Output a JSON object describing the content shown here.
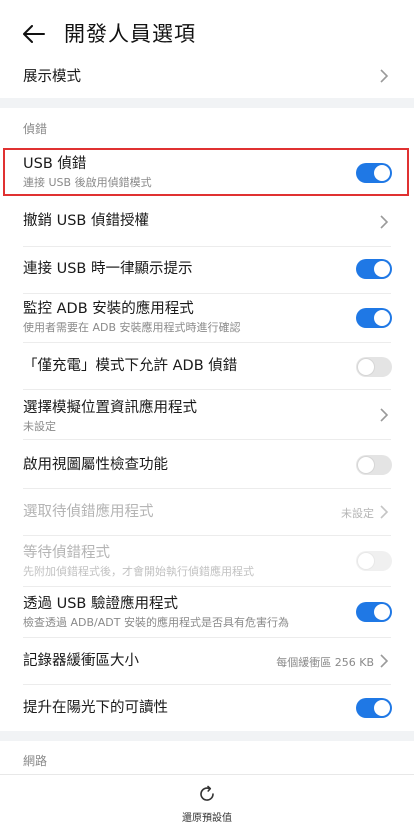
{
  "header": {
    "title": "開發人員選項"
  },
  "display_mode": {
    "label": "展示模式"
  },
  "debug_section": {
    "label": "偵錯"
  },
  "usb_debug": {
    "label": "USB 偵錯",
    "desc": "連接 USB 後啟用偵錯模式",
    "state": "on"
  },
  "revoke_usb": {
    "label": "撤銷 USB 偵錯授權"
  },
  "usb_notify": {
    "label": "連接 USB 時一律顯示提示",
    "state": "on"
  },
  "monitor_adb": {
    "label": "監控 ADB 安裝的應用程式",
    "desc": "使用者需要在 ADB 安裝應用程式時進行確認",
    "state": "on"
  },
  "charge_only_adb": {
    "label": "「僅充電」模式下允許 ADB 偵錯",
    "state": "off"
  },
  "mock_location": {
    "label": "選擇模擬位置資訊應用程式",
    "desc": "未設定"
  },
  "view_attr": {
    "label": "啟用視圖屬性檢查功能",
    "state": "off"
  },
  "debug_app": {
    "label": "選取待偵錯應用程式",
    "value": "未設定"
  },
  "wait_debugger": {
    "label": "等待偵錯程式",
    "desc": "先附加偵錯程式後，才會開始執行偵錯應用程式",
    "state": "off"
  },
  "verify_usb": {
    "label": "透過 USB 驗證應用程式",
    "desc": "檢查透過 ADB/ADT 安裝的應用程式是否具有危害行為",
    "state": "on"
  },
  "logger_buffer": {
    "label": "記錄器緩衝區大小",
    "value": "每個緩衝區 256 KB"
  },
  "sunlight": {
    "label": "提升在陽光下的可讀性",
    "state": "on"
  },
  "network_section": {
    "label": "網路"
  },
  "bottom": {
    "restore_label": "還原預設值"
  },
  "colors": {
    "accent": "#1f78e5",
    "highlight_border": "#e03131"
  }
}
